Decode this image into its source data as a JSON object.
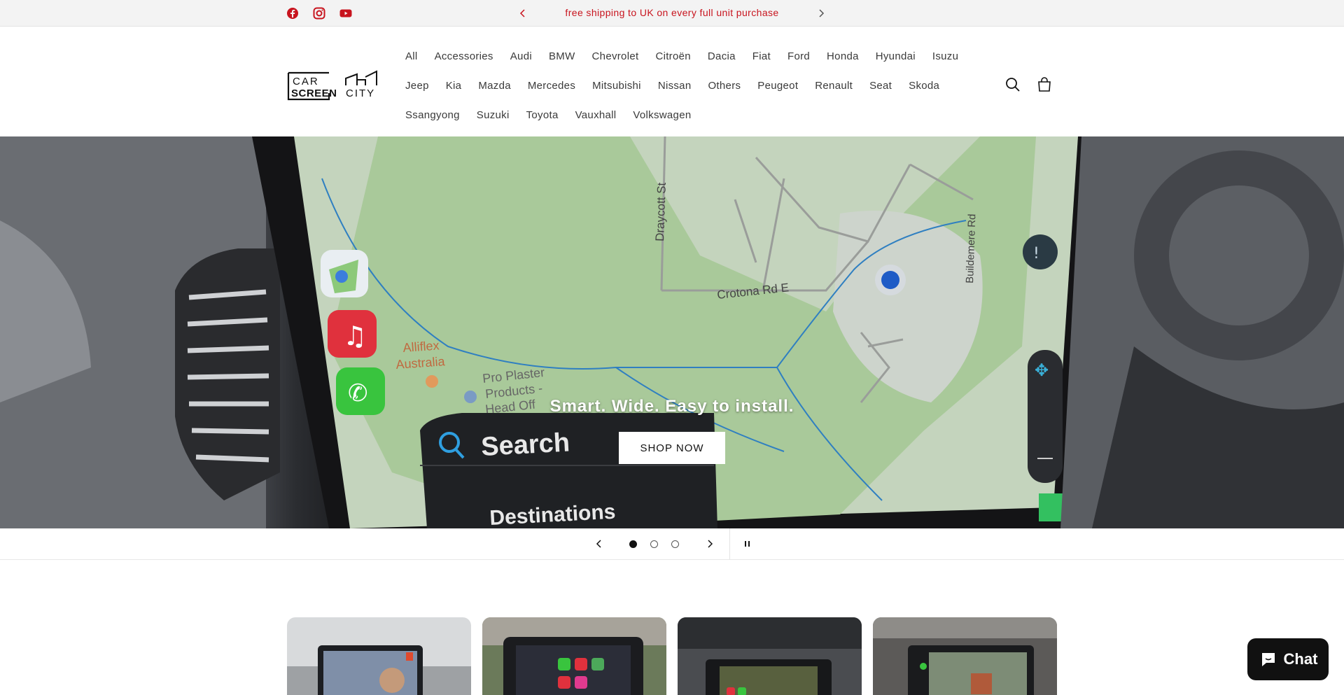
{
  "announcement": {
    "text": "free shipping to UK on every full unit purchase",
    "social_icons": [
      "facebook-icon",
      "instagram-icon",
      "youtube-icon"
    ]
  },
  "header": {
    "logo_text": "CAR SCREEN CITY",
    "nav": [
      "All",
      "Accessories",
      "Audi",
      "BMW",
      "Chevrolet",
      "Citroën",
      "Dacia",
      "Fiat",
      "Ford",
      "Honda",
      "Hyundai",
      "Isuzu",
      "Jeep",
      "Kia",
      "Mazda",
      "Mercedes",
      "Mitsubishi",
      "Nissan",
      "Others",
      "Peugeot",
      "Renault",
      "Seat",
      "Skoda",
      "Ssangyong",
      "Suzuki",
      "Toyota",
      "Vauxhall",
      "Volkswagen"
    ]
  },
  "hero": {
    "heading": "Smart. Wide. Easy to install.",
    "button": "SHOP NOW",
    "screen_labels": {
      "street1": "Draycott St",
      "street2": "Crotona Rd E",
      "street3": "Buildemere Rd",
      "poi1a": "Alliflex",
      "poi1b": "Australia",
      "poi2a": "Pro Plaster",
      "poi2b": "Products -",
      "poi2c": "Head Off",
      "search": "Search",
      "destinations": "Destinations"
    }
  },
  "slider": {
    "slide_count": 3,
    "active_index": 0
  },
  "chat": {
    "label": "Chat"
  },
  "colors": {
    "announcement_text": "#c8141e",
    "map_green": "#a9c99a",
    "map_blue": "#2f7fc1"
  }
}
